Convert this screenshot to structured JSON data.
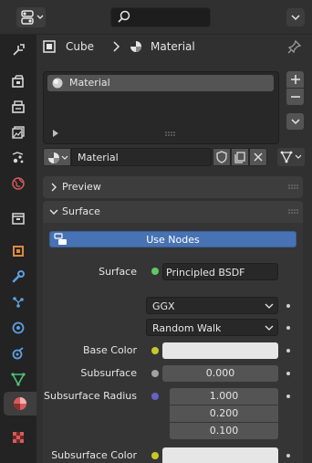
{
  "breadcrumb": {
    "object": "Cube",
    "material": "Material"
  },
  "material_slots": [
    {
      "name": "Material"
    }
  ],
  "datablock": {
    "name": "Material"
  },
  "panels": {
    "preview": "Preview",
    "surface": "Surface"
  },
  "surface": {
    "use_nodes_label": "Use Nodes",
    "surface_label": "Surface",
    "surface_shader": "Principled BSDF",
    "distribution": "GGX",
    "subsurface_method": "Random Walk",
    "base_color_label": "Base Color",
    "subsurface_label": "Subsurface",
    "subsurface_value": "0.000",
    "subsurface_radius_label": "Subsurface Radius",
    "subsurface_radius": [
      "1.000",
      "0.200",
      "0.100"
    ],
    "subsurface_color_label": "Subsurface Color"
  },
  "colors": {
    "accent": "#4772b3",
    "socket_color": "#c7c729",
    "socket_float": "#a1a1a1",
    "socket_vector": "#6363c7",
    "socket_shader": "#63c763"
  }
}
